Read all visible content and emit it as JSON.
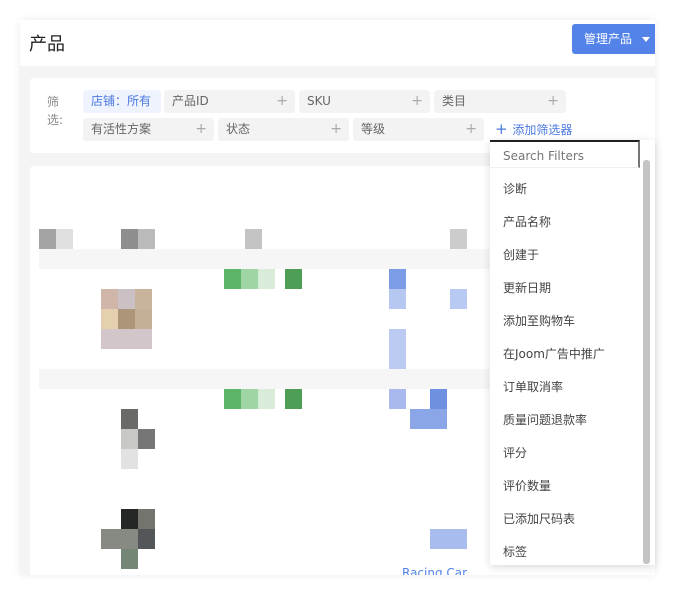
{
  "header": {
    "title": "产品",
    "manage_button": "管理产品"
  },
  "filters": {
    "label": "筛选:",
    "chips": [
      {
        "label": "店铺：所有",
        "active": true
      },
      {
        "label": "产品ID"
      },
      {
        "label": "SKU"
      },
      {
        "label": "类目"
      },
      {
        "label": "有活性方案"
      },
      {
        "label": "状态"
      },
      {
        "label": "等级"
      }
    ],
    "add_filter": "添加筛选器"
  },
  "table": {
    "visible_link": "Racing Car"
  },
  "dropdown": {
    "search_placeholder": "Search Filters",
    "options": [
      "诊断",
      "产品名称",
      "创建于",
      "更新日期",
      "添加至购物车",
      "在Joom广告中推广",
      "订单取消率",
      "质量问题退款率",
      "评分",
      "评价数量",
      "已添加尺码表",
      "标签"
    ]
  }
}
